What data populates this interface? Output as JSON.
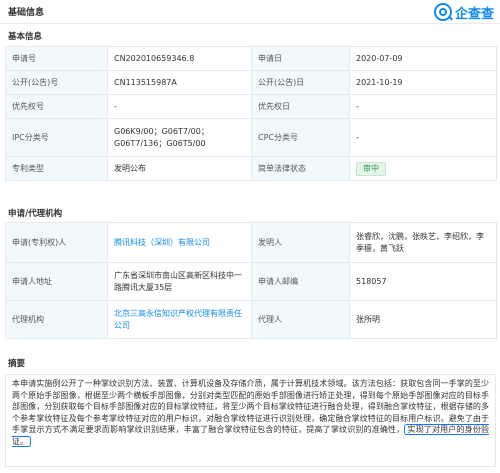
{
  "header": {
    "title": "基础信息",
    "logo_text": "企查查"
  },
  "basic": {
    "section_title": "基本信息",
    "rows": [
      {
        "l1": "申请号",
        "v1": "CN202010659346.8",
        "l2": "申请日",
        "v2": "2020-07-09"
      },
      {
        "l1": "公开(公告)号",
        "v1": "CN113515987A",
        "l2": "公开(公告)日",
        "v2": "2021-10-19"
      },
      {
        "l1": "优先权号",
        "v1": "-",
        "l2": "优先权日",
        "v2": "-"
      },
      {
        "l1": "IPC分类号",
        "v1": "G06K9/00；G06T7/00；G06T7/136；G06T5/00",
        "l2": "CPC分类号",
        "v2": "-"
      },
      {
        "l1": "专利类型",
        "v1": "发明公布",
        "l2": "简单法律状态",
        "v2": "审中"
      }
    ]
  },
  "agency": {
    "section_title": "申请/代理机构",
    "rows": [
      {
        "l1": "申请(专利权)人",
        "v1": "腾讯科技（深圳）有限公司",
        "l2": "发明人",
        "v2": "张睿欣，沈鹏，张昳艺，李绍欣，李季檩，黄飞跃"
      },
      {
        "l1": "申请人地址",
        "v1": "广东省深圳市南山区高新区科技中一路腾讯大厦35层",
        "l2": "申请人邮编",
        "v2": "518057"
      },
      {
        "l1": "代理机构",
        "v1": "北京三高永信知识产权代理有限责任公司",
        "l2": "代理人",
        "v2": "张所明"
      }
    ]
  },
  "abstract": {
    "section_title": "摘要",
    "text": "本申请实施例公开了一种掌纹识别方法、装置、计算机设备及存储介质，属于计算机技术领域。该方法包括：获取包含同一手掌的至少两个原始手部图像，根据至少两个横板手部图像，分别对类型匹配的原始手部图像进行矫正处理，得到每个原始手部图像对应的目标手部图像，分别获取每个目标手部图像对应的目标掌纹特征，将至少两个目标掌纹特征进行融合处理，得到融合掌纹特征，根据存储的多个参考掌纹特征及每个参考掌纹特征对应的用户标识，对融合掌纹特征进行识别处理，确定融合掌纹特征的目标用户标识。避免了由于手掌显示方式不满足要求而影响掌纹识别结果，丰富了融合掌纹特征包含的特征，提高了掌纹识别的准确性，",
    "highlight": "实现了对用户的身份验证。"
  }
}
